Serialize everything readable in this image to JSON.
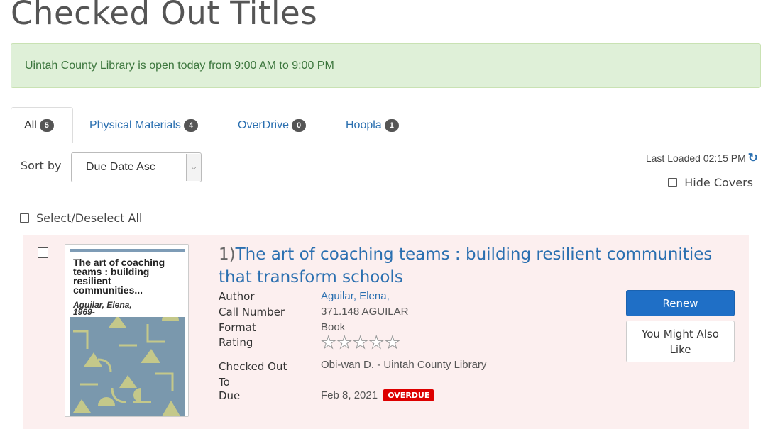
{
  "page": {
    "title": "Checked Out Titles"
  },
  "alert": {
    "text": "Uintah County Library is open today from 9:00 AM to 9:00 PM"
  },
  "tabs": [
    {
      "label": "All",
      "count": "5"
    },
    {
      "label": "Physical Materials",
      "count": "4"
    },
    {
      "label": "OverDrive",
      "count": "0"
    },
    {
      "label": "Hoopla",
      "count": "1"
    }
  ],
  "toolbar": {
    "sort_label": "Sort by",
    "sort_value": "Due Date Asc",
    "last_loaded": "Last Loaded 02:15 PM",
    "hide_covers": "Hide Covers",
    "select_all": "Select/Deselect All"
  },
  "record": {
    "number": "1)",
    "title": "The art of coaching teams : building resilient communities that transform schools",
    "cover_title": "The art of coaching teams : building resilient communities...",
    "cover_author": "Aguilar, Elena, 1969-",
    "labels": {
      "author": "Author",
      "call_number": "Call Number",
      "format": "Format",
      "rating": "Rating",
      "checked_out_to": "Checked Out To",
      "due": "Due"
    },
    "values": {
      "author": "Aguilar, Elena,",
      "call_number": "371.148 AGUILAR",
      "format": "Book",
      "checked_out_to": "Obi-wan D. - Uintah County Library",
      "due": "Feb 8, 2021"
    },
    "rating_stars": 0,
    "overdue_badge": "OVERDUE",
    "renew_label": "Renew",
    "like_label": "You Might Also Like"
  },
  "colors": {
    "link": "#2a6fb0",
    "alert_bg": "#dff0d8",
    "record_bg": "#fcefef",
    "renew": "#1f6fc6",
    "overdue": "#dd0000"
  }
}
